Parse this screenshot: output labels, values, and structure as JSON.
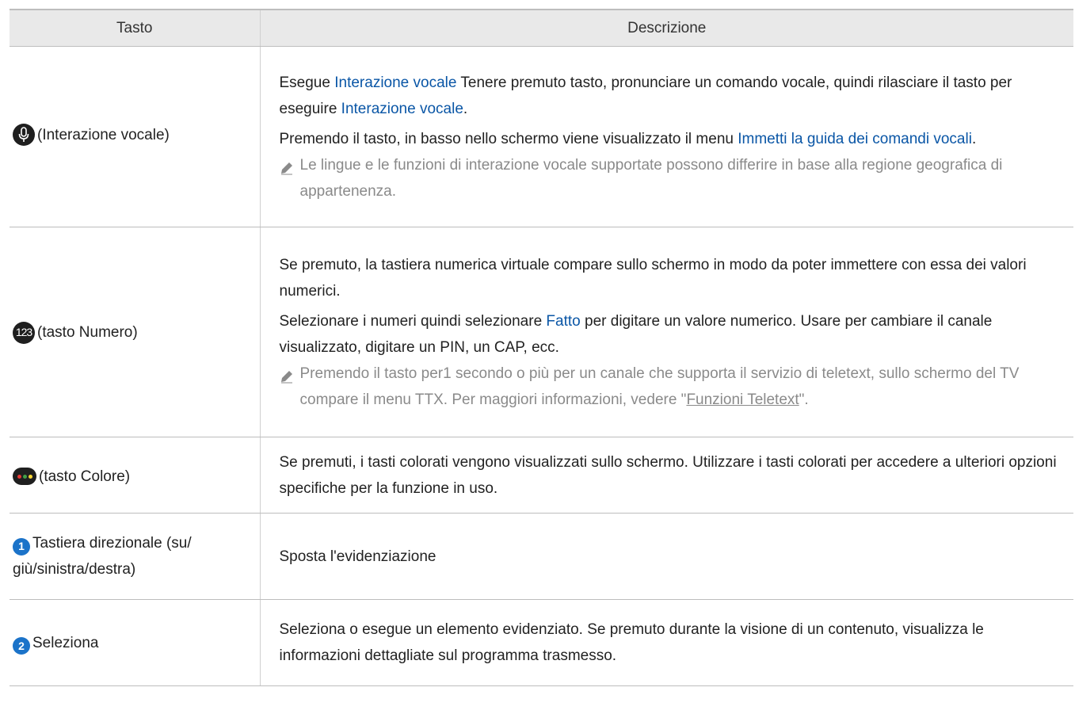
{
  "table": {
    "headers": {
      "key": "Tasto",
      "description": "Descrizione"
    },
    "rows": {
      "voice": {
        "key_label": "(Interazione vocale)",
        "icon": "microphone-icon",
        "p1_a": "Esegue ",
        "p1_b": "Interazione vocale",
        "p1_c": " Tenere premuto tasto, pronunciare un comando vocale, quindi rilasciare il tasto per eseguire ",
        "p1_d": "Interazione vocale",
        "p1_e": ".",
        "p2_a": "Premendo il tasto, in basso nello schermo viene visualizzato il menu ",
        "p2_b": "Immetti la guida dei comandi vocali",
        "p2_c": ".",
        "note": "Le lingue e le funzioni di interazione vocale supportate possono differire in base alla regione geografica di appartenenza."
      },
      "number": {
        "icon_text": "123",
        "key_label": "(tasto Numero)",
        "p1": "Se premuto, la tastiera numerica virtuale compare sullo schermo in modo da poter immettere con essa dei valori numerici.",
        "p2_a": "Selezionare i numeri quindi selezionare ",
        "p2_b": "Fatto",
        "p2_c": " per digitare un valore numerico. Usare per cambiare il canale visualizzato, digitare un PIN, un CAP, ecc.",
        "note_a": "Premendo il tasto per1 secondo o più per un canale che supporta il servizio di teletext, sullo schermo del TV compare il menu TTX. Per maggiori informazioni, vedere \"",
        "note_link": "Funzioni Teletext",
        "note_b": "\"."
      },
      "color": {
        "key_label": "(tasto Colore)",
        "icon": "color-key-icon",
        "dot_colors": [
          "#e53935",
          "#43a047",
          "#fdd835"
        ],
        "p1": "Se premuti, i tasti colorati vengono visualizzati sullo schermo. Utilizzare i tasti colorati per accedere a ulteriori opzioni specifiche per la funzione in uso."
      },
      "directional": {
        "badge": "1",
        "key_label": "Tastiera direzionale (su/ giù/sinistra/destra)",
        "p1": "Sposta l'evidenziazione"
      },
      "select": {
        "badge": "2",
        "key_label": "Seleziona",
        "p1": "Seleziona o esegue un elemento evidenziato. Se premuto durante la visione di un contenuto, visualizza le informazioni dettagliate sul programma trasmesso."
      }
    }
  },
  "colors": {
    "link": "#0a56a6",
    "note": "#8a8a8a",
    "header_bg": "#e9e9e9",
    "badge": "#1b73c9"
  }
}
